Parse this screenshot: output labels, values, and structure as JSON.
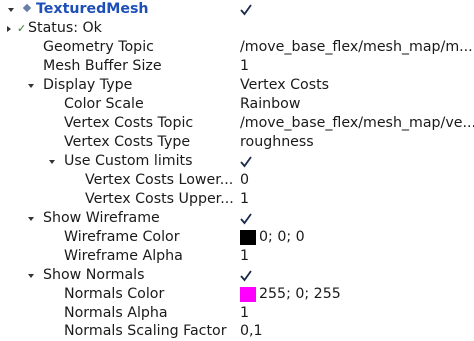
{
  "display": {
    "name": "TexturedMesh",
    "enabled": true,
    "status": {
      "check_glyph": "✓",
      "label": "Status: Ok"
    },
    "properties": {
      "geometry_topic": {
        "label": "Geometry Topic",
        "value": "/move_base_flex/mesh_map/m..."
      },
      "mesh_buffer_size": {
        "label": "Mesh Buffer Size",
        "value": "1"
      },
      "display_type": {
        "label": "Display Type",
        "value": "Vertex Costs",
        "color_scale": {
          "label": "Color Scale",
          "value": "Rainbow"
        },
        "vertex_costs_topic": {
          "label": "Vertex Costs Topic",
          "value": "/move_base_flex/mesh_map/ve..."
        },
        "vertex_costs_type": {
          "label": "Vertex Costs Type",
          "value": "roughness"
        },
        "use_custom_limits": {
          "label": "Use Custom limits",
          "checked": true,
          "lower": {
            "label": "Vertex Costs Lower...",
            "value": "0"
          },
          "upper": {
            "label": "Vertex Costs Upper...",
            "value": "1"
          }
        }
      },
      "show_wireframe": {
        "label": "Show Wireframe",
        "checked": true,
        "color": {
          "label": "Wireframe Color",
          "swatch": "#000000",
          "value": "0; 0; 0"
        },
        "alpha": {
          "label": "Wireframe Alpha",
          "value": "1"
        }
      },
      "show_normals": {
        "label": "Show Normals",
        "checked": true,
        "color": {
          "label": "Normals Color",
          "swatch": "#ff00ff",
          "value": "255; 0; 255"
        },
        "alpha": {
          "label": "Normals Alpha",
          "value": "1"
        },
        "scaling": {
          "label": "Normals Scaling Factor",
          "value": "0,1"
        }
      }
    }
  },
  "colors": {
    "title": "#1e4fb8",
    "checkmark": "#1a2a4a"
  }
}
